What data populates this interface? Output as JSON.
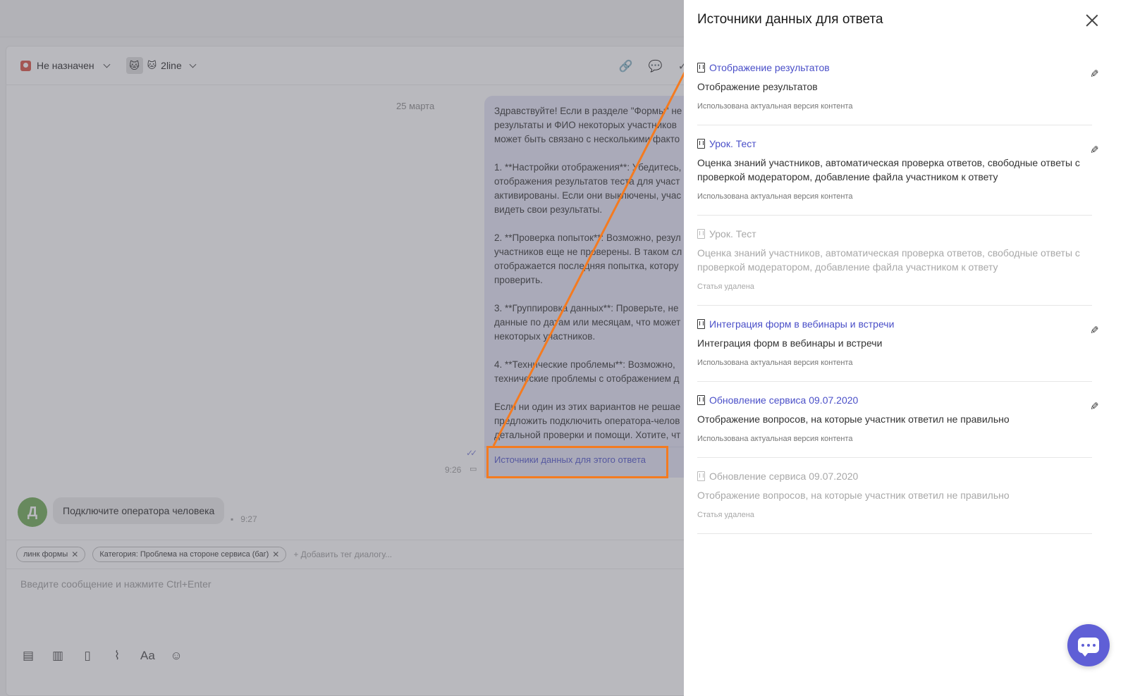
{
  "chat": {
    "assignee_label": "Не назначен",
    "line_label": "2line",
    "date_label": "25 марта",
    "bot_message": "Здравствуйте! Если в разделе \"Формы\" не\nрезультаты и ФИО некоторых участников\nможет быть связано с несколькими факто\n\n1. **Настройки отображения**: Убедитесь,\nотображения результатов теста для участ\nактивированы. Если они выключены, учас\nвидеть свои результаты.\n\n2. **Проверка попыток**: Возможно, резул\nучастников еще не проверены. В таком сл\nотображается последняя попытка, котору\nпроверить.\n\n3. **Группировка данных**: Проверьте, не\nданные по датам или месяцам, что может\nнекоторых участников.\n\n4. **Технические проблемы**: Возможно, \nтехнические проблемы с отображением д\n\nЕсли ни один из этих вариантов не решае\nпредложить подключить оператора-челов\nдетальной проверки и помощи. Хотите, чт",
    "sources_link": "Источники данных для этого ответа",
    "bot_time": "9:26",
    "user_initial": "Д",
    "user_message": "Подключите оператора человека",
    "user_time": "9:27",
    "tags": [
      {
        "label": "линк формы"
      },
      {
        "label": "Категория: Проблема на стороне сервиса (баг)"
      }
    ],
    "add_tag_placeholder": "+ Добавить тег диалогу...",
    "composer_placeholder": "Введите сообщение и нажмите Ctrl+Enter",
    "font_tool_label": "Aa"
  },
  "panel": {
    "title": "Источники данных для ответа",
    "sources": [
      {
        "title": "Отображение результатов",
        "desc": "Отображение результатов",
        "status": "Использована актуальная версия контента",
        "deleted": false
      },
      {
        "title": "Урок. Тест",
        "desc": "Оценка знаний участников, автоматическая проверка ответов, свободные ответы с проверкой модератором, добавление файла участником к ответу",
        "status": "Использована актуальная версия контента",
        "deleted": false
      },
      {
        "title": "Урок. Тест",
        "desc": "Оценка знаний участников, автоматическая проверка ответов, свободные ответы с проверкой модератором, добавление файла участником к ответу",
        "status": "Статья удалена",
        "deleted": true
      },
      {
        "title": "Интеграция форм в вебинары и встречи",
        "desc": "Интеграция форм в вебинары и встречи",
        "status": "Использована актуальная версия контента",
        "deleted": false
      },
      {
        "title": "Обновление сервиса 09.07.2020",
        "desc": "Отображение вопросов, на которые участник ответил не правильно",
        "status": "Использована актуальная версия контента",
        "deleted": false
      },
      {
        "title": "Обновление сервиса 09.07.2020",
        "desc": "Отображение вопросов, на которые участник ответил не правильно",
        "status": "Статья удалена",
        "deleted": true
      }
    ]
  },
  "colors": {
    "accent": "#4a4fc8",
    "annotation": "#f47b20",
    "fab": "#5f5fd6"
  }
}
